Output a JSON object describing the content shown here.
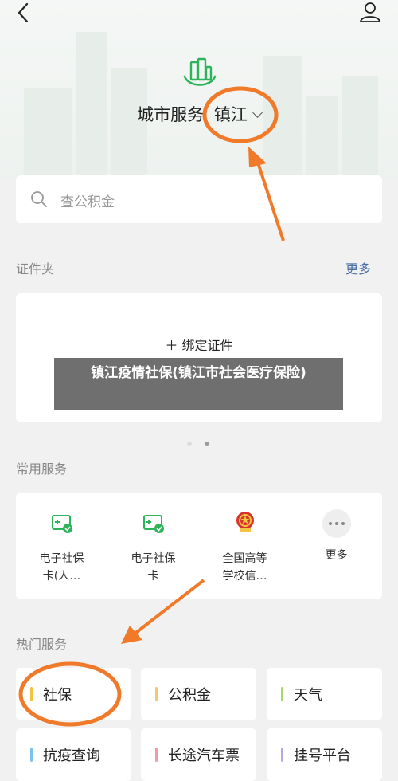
{
  "city_header": {
    "title": "城市服务",
    "city": "镇江"
  },
  "search": {
    "placeholder": "查公积金"
  },
  "wallet": {
    "title": "证件夹",
    "more": "更多",
    "bind_label": "＋ 绑定证件"
  },
  "overlay_caption": "镇江疫情社保(镇江市社会医疗保险)",
  "common_services": {
    "title": "常用服务",
    "items": [
      {
        "label_line1": "电子社保",
        "label_line2": "卡(人…",
        "icon": "social-security-card-icon"
      },
      {
        "label_line1": "电子社保",
        "label_line2": "卡",
        "icon": "social-security-card-icon"
      },
      {
        "label_line1": "全国高等",
        "label_line2": "学校信…",
        "icon": "national-emblem-icon"
      },
      {
        "label_line1": "更多",
        "label_line2": "",
        "icon": "more-dots-icon"
      }
    ]
  },
  "hot_services": {
    "title": "热门服务",
    "items": [
      {
        "label": "社保",
        "color": "#f5c342"
      },
      {
        "label": "公积金",
        "color": "#f0c87a"
      },
      {
        "label": "天气",
        "color": "#a6d86c"
      },
      {
        "label": "抗疫查询",
        "color": "#7cc3f0"
      },
      {
        "label": "长途汽车票",
        "color": "#f29aa8"
      },
      {
        "label": "挂号平台",
        "color": "#b9a6e6"
      }
    ]
  },
  "colors": {
    "brand_green": "#2db35a",
    "annotation_orange": "#f07a2a",
    "link_blue": "#4a6fa5"
  }
}
